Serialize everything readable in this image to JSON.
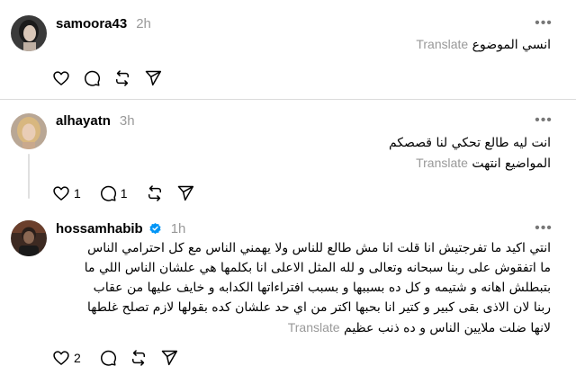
{
  "posts": [
    {
      "username": "samoora43",
      "time": "2h",
      "avatar": "woman-portrait",
      "lines": [
        "انسي الموضوع"
      ],
      "translate": "Translate",
      "likes": "",
      "replies": "",
      "verified": false
    },
    {
      "username": "alhayatn",
      "time": "3h",
      "avatar": "woman-portrait-blonde",
      "lines": [
        "انت ليه طالع تحكي لنا قصصكم",
        "المواضيع انتهت"
      ],
      "translate": "Translate",
      "likes": "1",
      "replies": "1",
      "verified": false
    },
    {
      "username": "hossamhabib",
      "time": "1h",
      "avatar": "man-portrait",
      "lines": [
        "انتي اكيد ما تفرجتيش انا قلت انا مش طالع للناس ولا يهمني الناس مع كل احترامي الناس",
        "ما اتفقوش على ربنا سبحانه وتعالى و لله المثل الاعلى انا بكلمها هي علشان الناس اللي ما",
        "بتبطلش اهانه و شتيمه و كل ده بسببها و بسبب افتراءاتها الكدابه و خايف عليها من عقاب",
        "ربنا لان الاذى بقى كبير و كتير انا بحبها اكتر من اي حد علشان كده بقولها لازم تصلح غلطها",
        "لانها ضلت ملايين الناس و ده ذنب عظيم"
      ],
      "translate": "Translate",
      "likes": "2",
      "replies": "",
      "verified": true
    }
  ],
  "icons": {
    "like": "heart-icon",
    "reply": "comment-icon",
    "repost": "repost-icon",
    "share": "send-icon",
    "more": "more-icon",
    "verified": "verified-badge-icon"
  },
  "colors": {
    "verified": "#0095f6",
    "muted": "#999999"
  }
}
